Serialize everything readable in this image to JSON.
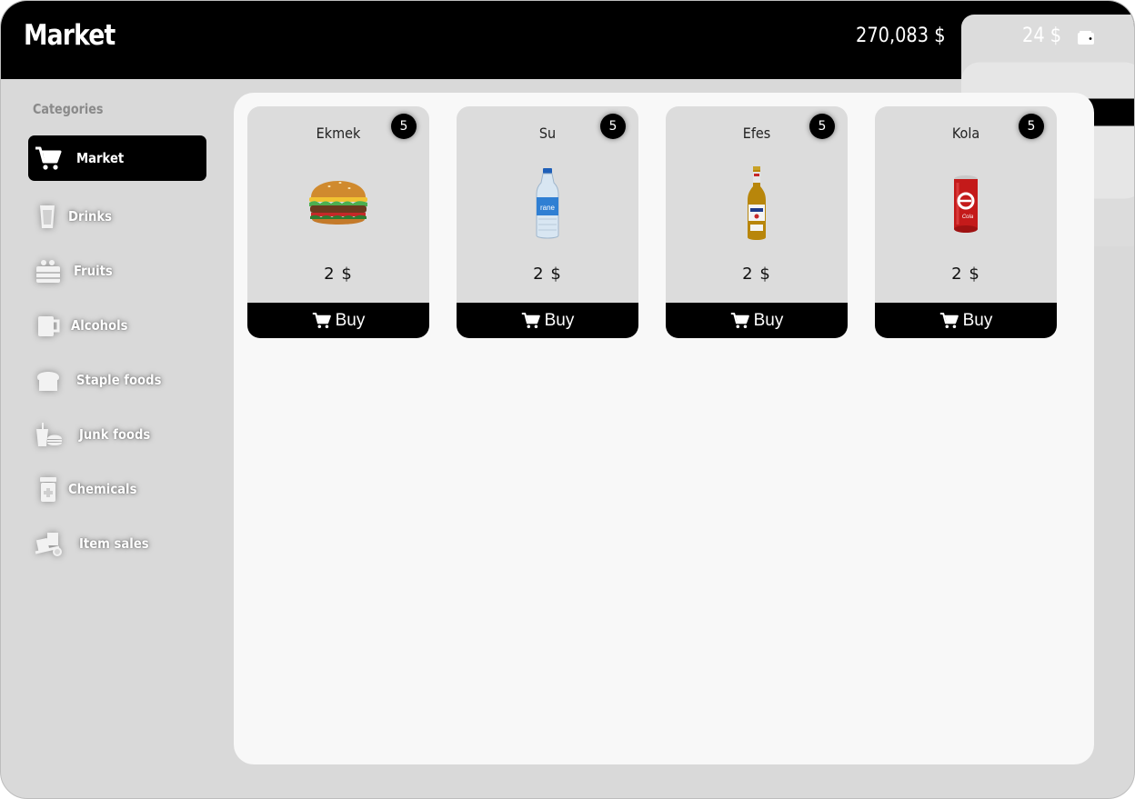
{
  "header": {
    "title": "Market",
    "bank_balance": "270,083 $",
    "cash_balance": "24 $",
    "bank_icon": "credit-card-icon",
    "cash_icon": "wallet-icon"
  },
  "sidebar": {
    "heading": "Categories",
    "items": [
      {
        "label": "Market",
        "icon": "cart-icon",
        "active": true
      },
      {
        "label": "Drinks",
        "icon": "cup-icon",
        "active": false
      },
      {
        "label": "Fruits",
        "icon": "crate-icon",
        "active": false
      },
      {
        "label": "Alcohols",
        "icon": "mug-icon",
        "active": false
      },
      {
        "label": "Staple foods",
        "icon": "bread-icon",
        "active": false
      },
      {
        "label": "Junk foods",
        "icon": "fastfood-icon",
        "active": false
      },
      {
        "label": "Chemicals",
        "icon": "bottle-icon",
        "active": false
      },
      {
        "label": "Item sales",
        "icon": "dolly-icon",
        "active": false
      }
    ]
  },
  "products": [
    {
      "name": "Ekmek",
      "stock": "5",
      "price": "2 $",
      "buy_label": "Buy",
      "image": "burger-image"
    },
    {
      "name": "Su",
      "stock": "5",
      "price": "2 $",
      "buy_label": "Buy",
      "image": "water-bottle-image"
    },
    {
      "name": "Efes",
      "stock": "5",
      "price": "2 $",
      "buy_label": "Buy",
      "image": "beer-bottle-image"
    },
    {
      "name": "Kola",
      "stock": "5",
      "price": "2 $",
      "buy_label": "Buy",
      "image": "cola-can-image"
    }
  ],
  "colors": {
    "header_bg": "#000000",
    "app_bg": "#d9d9d9",
    "content_bg": "#f8f8f8",
    "card_bg": "#dcdcdc",
    "accent": "#000000"
  }
}
